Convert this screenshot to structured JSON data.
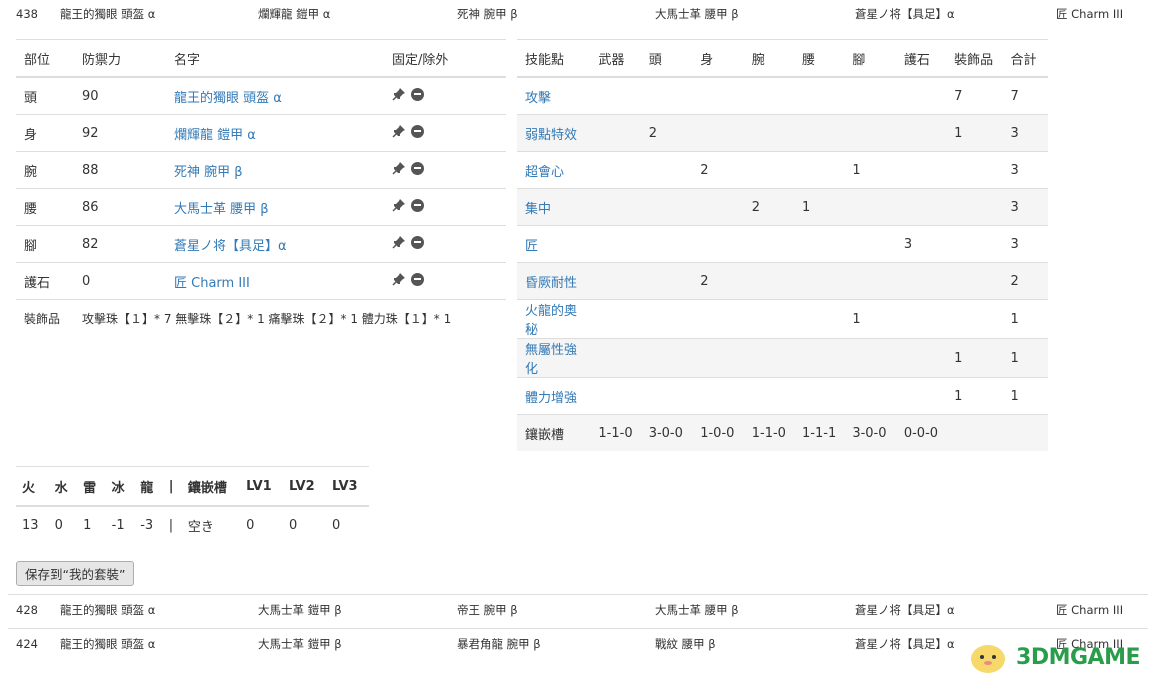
{
  "top_row": {
    "number": "438",
    "head": "龍王的獨眼 頭盔 α",
    "chest": "爛輝龍 鎧甲 α",
    "arms": "死神 腕甲 β",
    "waist": "大馬士革 腰甲 β",
    "legs": "蒼星ノ将【具足】α",
    "charm": "匠 Charm III"
  },
  "equipment_table": {
    "headers": [
      "部位",
      "防禦力",
      "名字",
      "固定/除外"
    ],
    "rows": [
      {
        "slot": "頭",
        "defense": "90",
        "name": "龍王的獨眼 頭盔 α"
      },
      {
        "slot": "身",
        "defense": "92",
        "name": "爛輝龍 鎧甲 α"
      },
      {
        "slot": "腕",
        "defense": "88",
        "name": "死神 腕甲 β"
      },
      {
        "slot": "腰",
        "defense": "86",
        "name": "大馬士革 腰甲 β"
      },
      {
        "slot": "腳",
        "defense": "82",
        "name": "蒼星ノ将【具足】α"
      },
      {
        "slot": "護石",
        "defense": "0",
        "name": "匠 Charm III"
      }
    ],
    "jewels_label": "裝飾品",
    "jewels_value": "攻擊珠【１】* 7 無擊珠【２】* 1 痛擊珠【２】* 1 體力珠【１】* 1"
  },
  "skill_table": {
    "headers": [
      "技能點",
      "武器",
      "頭",
      "身",
      "腕",
      "腰",
      "腳",
      "護石",
      "裝飾品",
      "合計"
    ],
    "rows": [
      {
        "skill": "攻擊",
        "cells": [
          "",
          "",
          "",
          "",
          "",
          "",
          "",
          "7",
          "7"
        ]
      },
      {
        "skill": "弱點特效",
        "cells": [
          "",
          "2",
          "",
          "",
          "",
          "",
          "",
          "1",
          "3"
        ]
      },
      {
        "skill": "超會心",
        "cells": [
          "",
          "",
          "2",
          "",
          "",
          "1",
          "",
          "",
          "3"
        ]
      },
      {
        "skill": "集中",
        "cells": [
          "",
          "",
          "",
          "2",
          "1",
          "",
          "",
          "",
          "3"
        ]
      },
      {
        "skill": "匠",
        "cells": [
          "",
          "",
          "",
          "",
          "",
          "",
          "3",
          "",
          "3"
        ]
      },
      {
        "skill": "昏厥耐性",
        "cells": [
          "",
          "",
          "2",
          "",
          "",
          "",
          "",
          "",
          "2"
        ]
      },
      {
        "skill": "火龍的奧秘",
        "cells": [
          "",
          "",
          "",
          "",
          "",
          "1",
          "",
          "",
          "1"
        ]
      },
      {
        "skill": "無屬性強化",
        "cells": [
          "",
          "",
          "",
          "",
          "",
          "",
          "",
          "1",
          "1"
        ]
      },
      {
        "skill": "體力增強",
        "cells": [
          "",
          "",
          "",
          "",
          "",
          "",
          "",
          "1",
          "1"
        ]
      }
    ],
    "slots_label": "鑲嵌槽",
    "slots": [
      "1-1-0",
      "3-0-0",
      "1-0-0",
      "1-1-0",
      "1-1-1",
      "3-0-0",
      "0-0-0"
    ]
  },
  "resist_table": {
    "headers": [
      "火",
      "水",
      "雷",
      "冰",
      "龍",
      "|",
      "鑲嵌槽",
      "LV1",
      "LV2",
      "LV3"
    ],
    "values": [
      "13",
      "0",
      "1",
      "-1",
      "-3",
      "|",
      "空き",
      "0",
      "0",
      "0"
    ]
  },
  "save_button": "保存到“我的套裝”",
  "other_rows": [
    {
      "number": "428",
      "head": "龍王的獨眼 頭盔 α",
      "chest": "大馬士革 鎧甲 β",
      "arms": "帝王 腕甲 β",
      "waist": "大馬士革 腰甲 β",
      "legs": "蒼星ノ将【具足】α",
      "charm": "匠 Charm III"
    },
    {
      "number": "424",
      "head": "龍王的獨眼 頭盔 α",
      "chest": "大馬士革 鎧甲 β",
      "arms": "暴君角龍 腕甲 β",
      "waist": "戰紋 腰甲 β",
      "legs": "蒼星ノ将【具足】α",
      "charm": "匠 Charm III"
    }
  ],
  "watermark": "3DMGAME",
  "colors": {
    "link": "#337ab7",
    "stripe": "#f5f5f5",
    "border": "#dddddd",
    "logo": "#2a9d4a"
  }
}
